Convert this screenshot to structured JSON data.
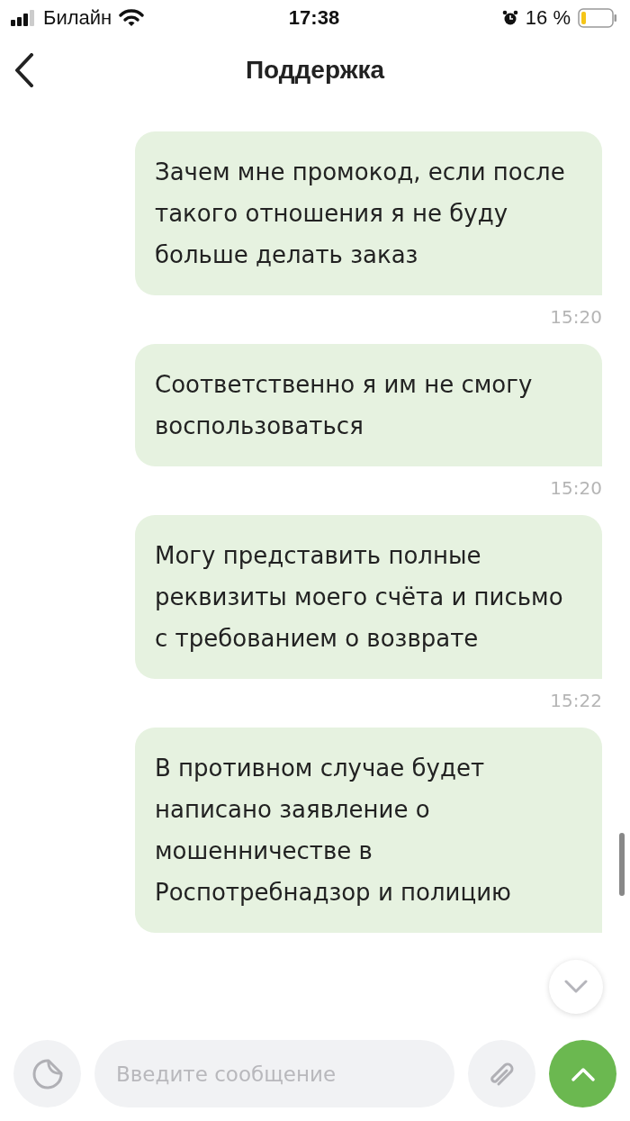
{
  "status_bar": {
    "carrier": "Билайн",
    "time": "17:38",
    "battery": "16 %"
  },
  "header": {
    "title": "Поддержка"
  },
  "messages": [
    {
      "text": "Зачем мне промокод, если после такого отношения я не буду больше делать заказ",
      "time": "15:20"
    },
    {
      "text": "Соответственно я им не смогу воспользоваться",
      "time": "15:20"
    },
    {
      "text": "Могу представить полные реквизиты моего счёта и письмо с требованием о возврате",
      "time": "15:22"
    },
    {
      "text": "В противном случае будет написано заявление о мошенничестве в Роспотребнадзор и полицию"
    }
  ],
  "composer": {
    "placeholder": "Введите сообщение"
  }
}
